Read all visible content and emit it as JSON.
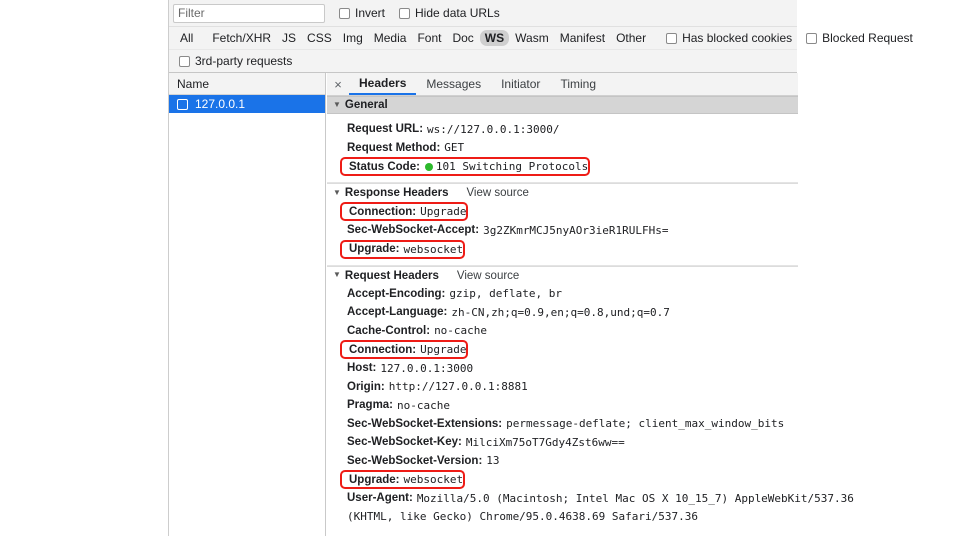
{
  "toolbar": {
    "filter_placeholder": "Filter",
    "filter_value": "",
    "invert_label": "Invert",
    "hide_data_urls_label": "Hide data URLs",
    "has_blocked_cookies_label": "Has blocked cookies",
    "blocked_requests_label": "Blocked Request",
    "third_party_label": "3rd-party requests"
  },
  "type_filters": [
    {
      "label": "All",
      "selected": false
    },
    {
      "label": "Fetch/XHR",
      "selected": false
    },
    {
      "label": "JS",
      "selected": false
    },
    {
      "label": "CSS",
      "selected": false
    },
    {
      "label": "Img",
      "selected": false
    },
    {
      "label": "Media",
      "selected": false
    },
    {
      "label": "Font",
      "selected": false
    },
    {
      "label": "Doc",
      "selected": false
    },
    {
      "label": "WS",
      "selected": true
    },
    {
      "label": "Wasm",
      "selected": false
    },
    {
      "label": "Manifest",
      "selected": false
    },
    {
      "label": "Other",
      "selected": false
    }
  ],
  "name_column": {
    "header": "Name",
    "rows": [
      {
        "label": "127.0.0.1",
        "selected": true
      }
    ]
  },
  "detail_tabs": {
    "close_icon": "×",
    "items": [
      {
        "label": "Headers",
        "active": true
      },
      {
        "label": "Messages",
        "active": false
      },
      {
        "label": "Initiator",
        "active": false
      },
      {
        "label": "Timing",
        "active": false
      }
    ]
  },
  "sections": {
    "general": {
      "title": "General",
      "rows": [
        {
          "key": "Request URL:",
          "value": "ws://127.0.0.1:3000/",
          "boxed": false,
          "dot": false
        },
        {
          "key": "Request Method:",
          "value": "GET",
          "boxed": false,
          "dot": false
        },
        {
          "key": "Status Code:",
          "value": "101 Switching Protocols",
          "boxed": true,
          "dot": true
        }
      ]
    },
    "response": {
      "title": "Response Headers",
      "view_source": "View source",
      "rows": [
        {
          "key": "Connection:",
          "value": "Upgrade",
          "boxed": true,
          "dot": false
        },
        {
          "key": "Sec-WebSocket-Accept:",
          "value": "3g2ZKmrMCJ5nyAOr3ieR1RULFHs=",
          "boxed": false,
          "dot": false
        },
        {
          "key": "Upgrade:",
          "value": "websocket",
          "boxed": true,
          "dot": false
        }
      ]
    },
    "request": {
      "title": "Request Headers",
      "view_source": "View source",
      "rows": [
        {
          "key": "Accept-Encoding:",
          "value": "gzip, deflate, br",
          "boxed": false,
          "dot": false
        },
        {
          "key": "Accept-Language:",
          "value": "zh-CN,zh;q=0.9,en;q=0.8,und;q=0.7",
          "boxed": false,
          "dot": false
        },
        {
          "key": "Cache-Control:",
          "value": "no-cache",
          "boxed": false,
          "dot": false
        },
        {
          "key": "Connection:",
          "value": "Upgrade",
          "boxed": true,
          "dot": false
        },
        {
          "key": "Host:",
          "value": "127.0.0.1:3000",
          "boxed": false,
          "dot": false
        },
        {
          "key": "Origin:",
          "value": "http://127.0.0.1:8881",
          "boxed": false,
          "dot": false
        },
        {
          "key": "Pragma:",
          "value": "no-cache",
          "boxed": false,
          "dot": false
        },
        {
          "key": "Sec-WebSocket-Extensions:",
          "value": "permessage-deflate; client_max_window_bits",
          "boxed": false,
          "dot": false
        },
        {
          "key": "Sec-WebSocket-Key:",
          "value": "MilciXm75oT7Gdy4Zst6ww==",
          "boxed": false,
          "dot": false
        },
        {
          "key": "Sec-WebSocket-Version:",
          "value": "13",
          "boxed": false,
          "dot": false
        },
        {
          "key": "Upgrade:",
          "value": "websocket",
          "boxed": true,
          "dot": false
        },
        {
          "key": "User-Agent:",
          "value": "Mozilla/5.0 (Macintosh; Intel Mac OS X 10_15_7) AppleWebKit/537.36",
          "boxed": false,
          "dot": false
        }
      ],
      "user_agent_continuation": "(KHTML, like Gecko) Chrome/95.0.4638.69 Safari/537.36"
    }
  },
  "colors": {
    "accent_blue": "#1a73e8",
    "highlight_red": "#ee1c16",
    "status_green": "#2cb92c",
    "toolbar_bg": "#f3f3f3",
    "section_header_bg": "#d5d5d5"
  }
}
